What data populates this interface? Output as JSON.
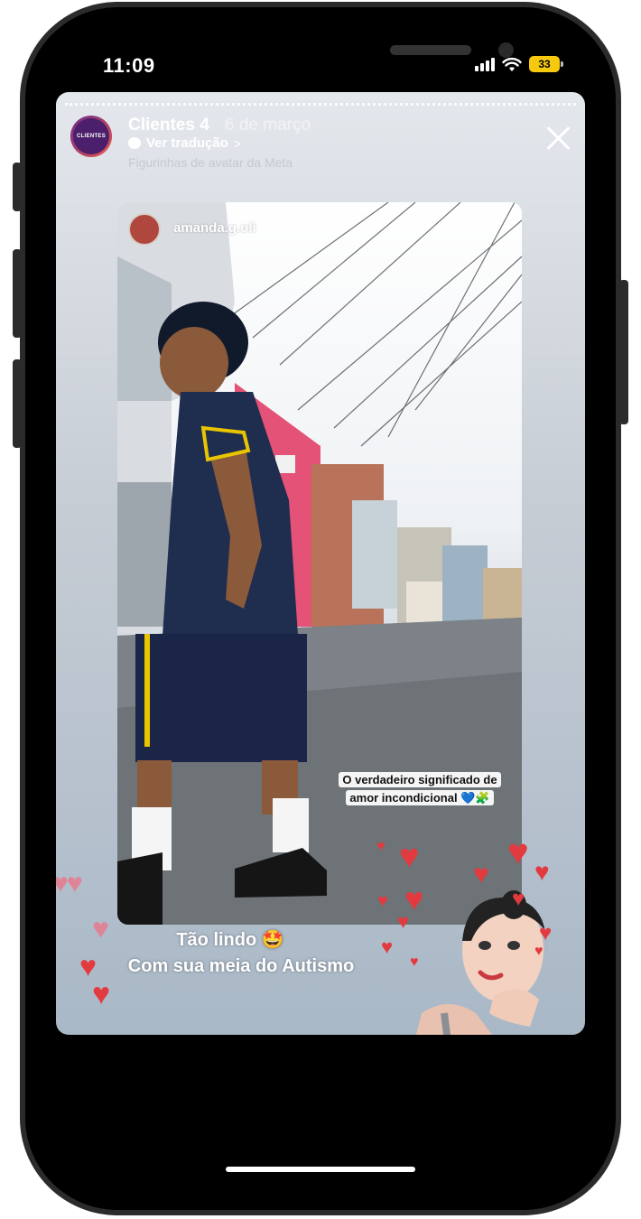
{
  "status_bar": {
    "time": "11:09",
    "battery": "33"
  },
  "story": {
    "account_name": "Clientes 4",
    "date": "6 de março",
    "translate_label": "Ver tradução",
    "faded_caption": "Figurinhas de avatar da Meta",
    "avatar_label": "CLIENTES",
    "poster_username": "amanda.g.oli",
    "quote_line1": "O verdadeiro significado de",
    "quote_line2": "amor incondicional 💙🧩",
    "caption_line1": "Tão lindo 🤩",
    "caption_line2": "Com sua meia do Autismo"
  },
  "colors": {
    "heart": "#e23a3f",
    "battery": "#f6c90e",
    "avatar_bg": "#4b1f6b"
  }
}
